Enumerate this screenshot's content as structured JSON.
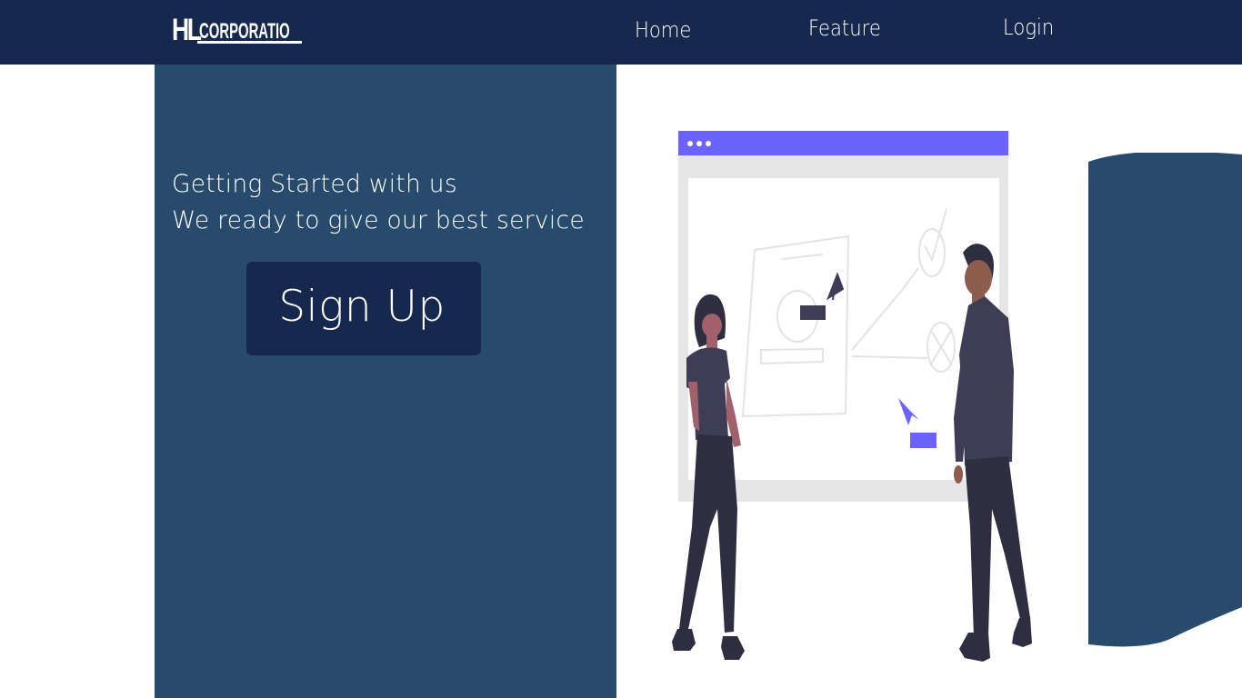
{
  "nav": {
    "logo_hl": "HL",
    "logo_text": "CORPORATIO",
    "links": [
      "Home",
      "Feature",
      "Login"
    ]
  },
  "hero": {
    "line1": "Getting Started with us",
    "line2": "We ready to give our best service",
    "signup_label": "Sign Up"
  },
  "colors": {
    "navbar": "#17284f",
    "panel": "#284a6d",
    "accent": "#6c63ff"
  },
  "icons": [
    "cursor-arrow-icon",
    "window-dots-icon"
  ]
}
